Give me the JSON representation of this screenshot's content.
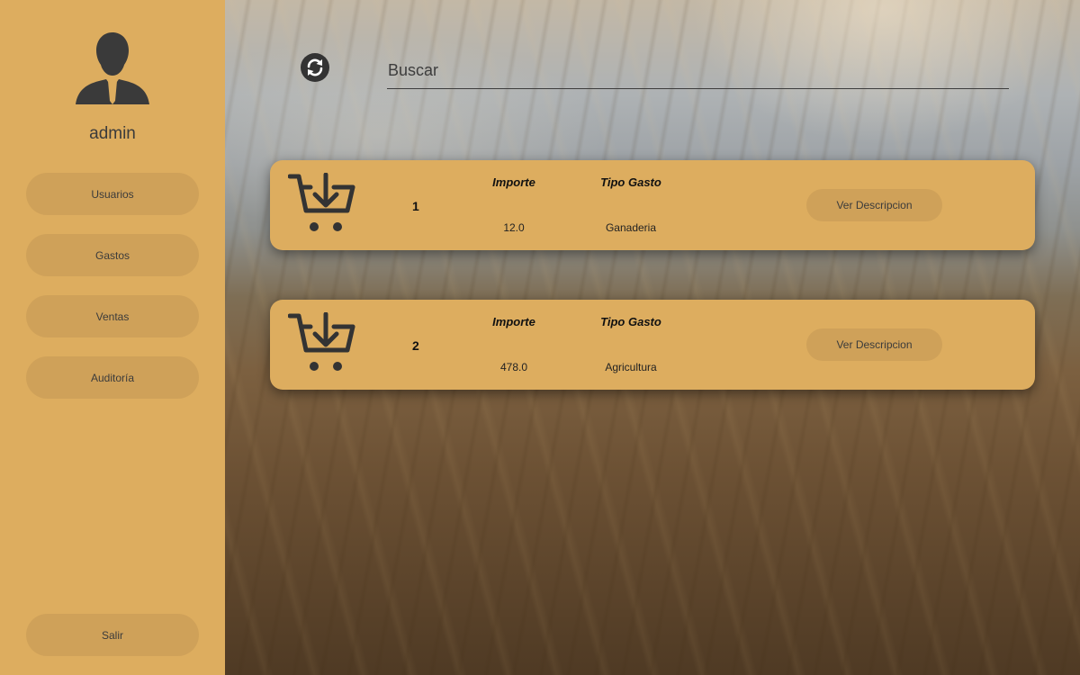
{
  "sidebar": {
    "username": "admin",
    "nav": [
      {
        "label": "Usuarios"
      },
      {
        "label": "Gastos"
      },
      {
        "label": "Ventas"
      },
      {
        "label": "Auditoría"
      }
    ],
    "logout_label": "Salir"
  },
  "search": {
    "placeholder": "Buscar"
  },
  "cards": [
    {
      "id": "1",
      "importe_label": "Importe",
      "importe": "12.0",
      "tipo_label": "Tipo Gasto",
      "tipo": "Ganaderia",
      "button_label": "Ver Descripcion"
    },
    {
      "id": "2",
      "importe_label": "Importe",
      "importe": "478.0",
      "tipo_label": "Tipo Gasto",
      "tipo": "Agricultura",
      "button_label": "Ver Descripcion"
    }
  ],
  "colors": {
    "accent": "#ddad5f",
    "button": "#cfa159",
    "icon": "#333333"
  },
  "icons": {
    "avatar": "user-avatar-icon",
    "refresh": "refresh-icon",
    "card": "cart-download-icon"
  }
}
